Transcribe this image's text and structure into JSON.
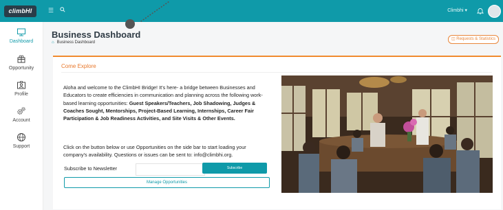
{
  "topbar": {
    "logo_text": "climbHI",
    "user_label": "Climbhi ▾",
    "menu_icon": "hamburger-icon",
    "search_icon": "search-icon",
    "bell_icon": "bell-icon",
    "avatar_icon": "user-avatar"
  },
  "sidebar": {
    "items": [
      {
        "label": "Dashboard",
        "icon": "monitor-icon"
      },
      {
        "label": "Opportunity",
        "icon": "gift-icon"
      },
      {
        "label": "Profile",
        "icon": "id-card-icon"
      },
      {
        "label": "Account",
        "icon": "gears-icon"
      },
      {
        "label": "Support",
        "icon": "globe-icon"
      }
    ]
  },
  "page": {
    "title": "Business Dashboard",
    "breadcrumb": "Business Dashboard",
    "requests_button": "Requests & Statistics"
  },
  "card": {
    "title": "Come Explore",
    "intro_plain": "Aloha and welcome to the ClimbHI Bridge! It's here- a bridge between Businesses and Educators to create efficiencies in communication and planning across the following work-based learning opportunities: ",
    "intro_bold": "Guest Speakers/Teachers, Job Shadowing, Judges & Coaches Sought, Mentorships, Project-Based Learning, Internships, Career Fair Participation & Job Readiness Activities, and Site Visits & Other Events.",
    "cta_text": "Click on the button below or use Opportunities on the side bar to start loading your company's availability. Questions or issues can be sent to: info@climbhi.org.",
    "newsletter_label": "Subscribe to Newsletter",
    "newsletter_placeholder": "",
    "subscribe_button": "Subscribe",
    "manage_button": "Manage Opportunities"
  },
  "colors": {
    "accent": "#0f9aa9",
    "highlight": "#f08a2d",
    "logo_bg": "#2a3d49"
  }
}
